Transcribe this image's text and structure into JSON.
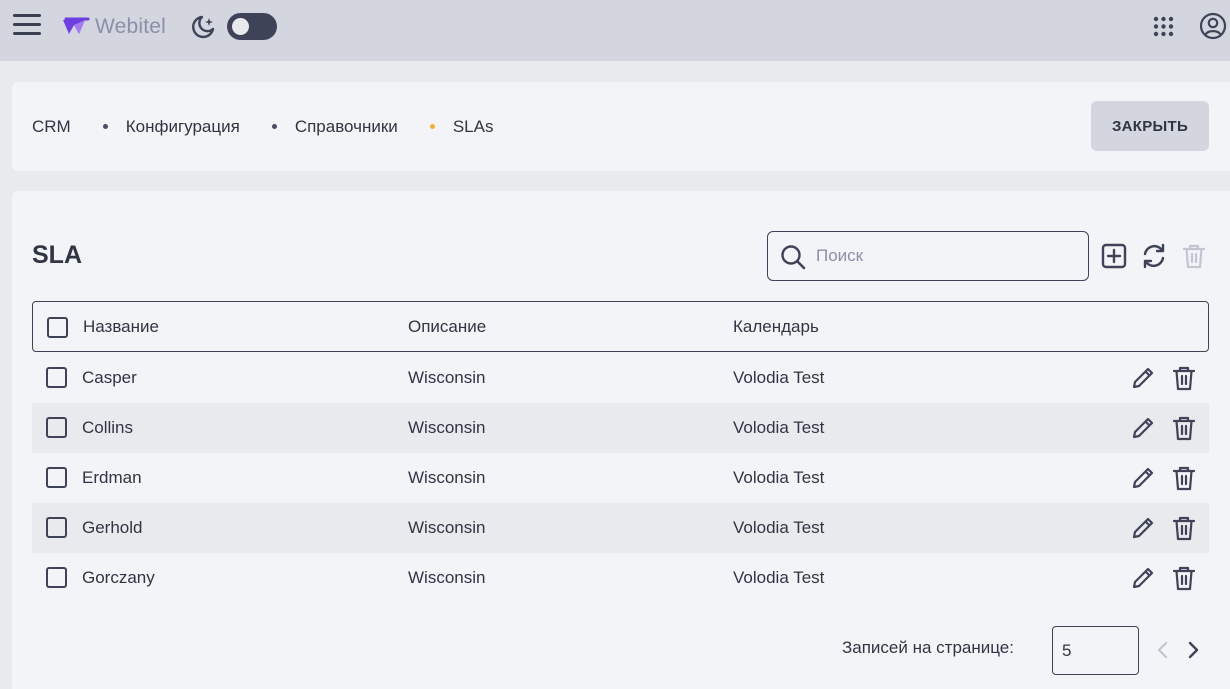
{
  "app": {
    "logo_text": "Webitel",
    "brand_color": "#7b3fe4",
    "theme_toggle_on": false
  },
  "breadcrumbs": [
    "CRM",
    "Конфигурация",
    "Справочники",
    "SLAs"
  ],
  "header": {
    "close_label": "ЗАКРЫТЬ"
  },
  "main": {
    "title": "SLA",
    "search_placeholder": "Поиск",
    "toolbar_icons": [
      "add-icon",
      "refresh-icon",
      "delete-icon"
    ],
    "columns": [
      "Название",
      "Описание",
      "Календарь"
    ],
    "rows": [
      {
        "name": "Casper",
        "description": "Wisconsin",
        "calendar": "Volodia Test"
      },
      {
        "name": "Collins",
        "description": "Wisconsin",
        "calendar": "Volodia Test"
      },
      {
        "name": "Erdman",
        "description": "Wisconsin",
        "calendar": "Volodia Test"
      },
      {
        "name": "Gerhold",
        "description": "Wisconsin",
        "calendar": "Volodia Test"
      },
      {
        "name": "Gorczany",
        "description": "Wisconsin",
        "calendar": "Volodia Test"
      }
    ]
  },
  "pagination": {
    "per_page_label": "Записей на странице:",
    "per_page_value": "5"
  }
}
